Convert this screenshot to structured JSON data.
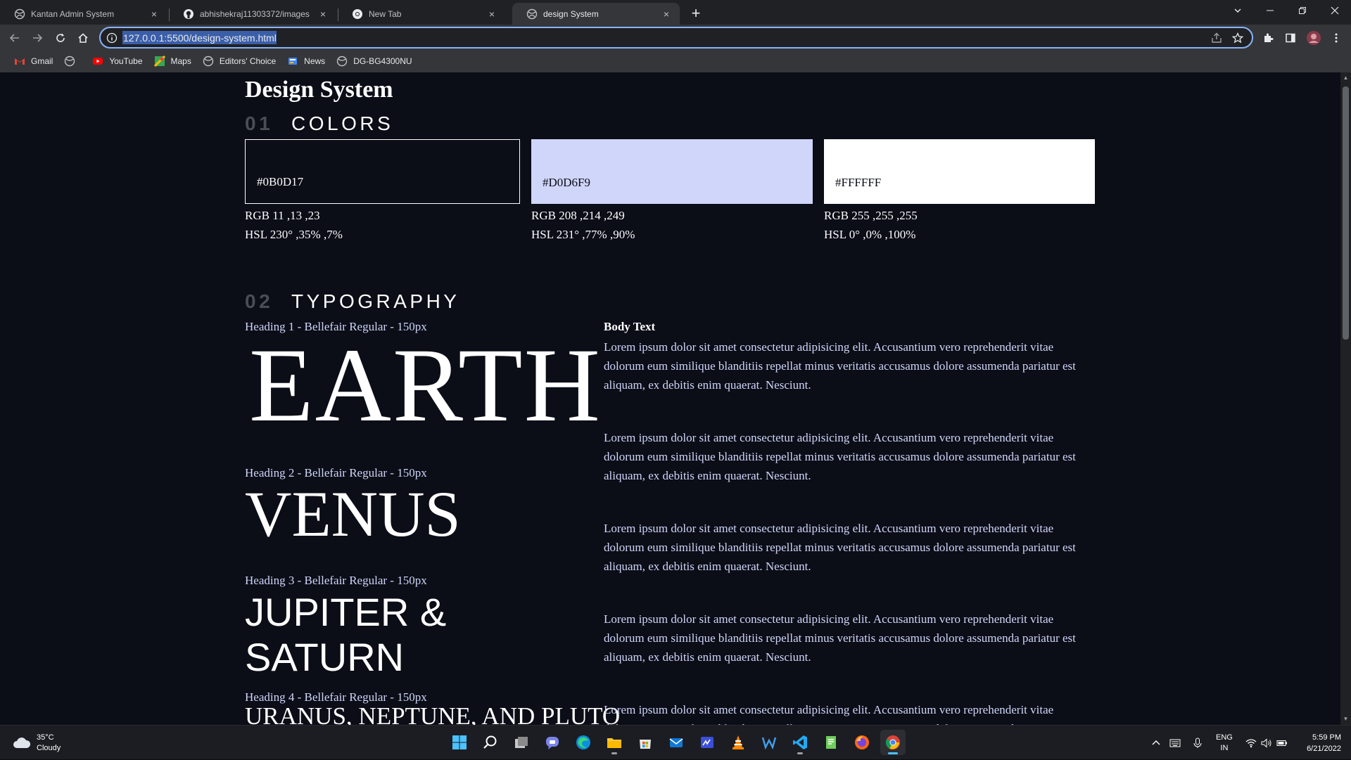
{
  "browser": {
    "tabs": [
      {
        "title": "Kantan Admin System",
        "icon": "globe-icon",
        "active": false
      },
      {
        "title": "abhishekraj11303372/images",
        "icon": "github-icon",
        "active": false
      },
      {
        "title": "New Tab",
        "icon": "chrome-icon",
        "active": false
      },
      {
        "title": "design System",
        "icon": "globe-icon",
        "active": true
      }
    ],
    "tab_close_glyph": "×",
    "new_tab_glyph": "+",
    "url": "127.0.0.1:5500/design-system.html",
    "bookmarks": [
      {
        "label": "Gmail",
        "icon": "gmail-icon"
      },
      {
        "label": "",
        "icon": "globe-icon"
      },
      {
        "label": "YouTube",
        "icon": "youtube-icon"
      },
      {
        "label": "Maps",
        "icon": "maps-icon"
      },
      {
        "label": "Editors' Choice",
        "icon": "globe-icon"
      },
      {
        "label": "News",
        "icon": "news-icon"
      },
      {
        "label": "DG-BG4300NU",
        "icon": "globe-icon"
      }
    ],
    "colors": {
      "accent": "#8ab4f8",
      "tabbar": "#202124",
      "toolbar": "#35363a"
    }
  },
  "page": {
    "title": "Design System",
    "sections": {
      "colors": {
        "num": "01",
        "name": "COLORS"
      },
      "typography": {
        "num": "02",
        "name": "TYPOGRAPHY"
      }
    },
    "swatches": [
      {
        "hex": "#0B0D17",
        "rgb": "RGB 11 ,13 ,23",
        "hsl": "HSL 230° ,35% ,7%",
        "color": "#0B0D17"
      },
      {
        "hex": "#D0D6F9",
        "rgb": "RGB 208 ,214 ,249",
        "hsl": "HSL 231° ,77% ,90%",
        "color": "#D0D6F9"
      },
      {
        "hex": "#FFFFFF",
        "rgb": "RGB 255 ,255 ,255",
        "hsl": "HSL 0° ,0% ,100%",
        "color": "#FFFFFF"
      }
    ],
    "typography": {
      "h1_label": "Heading 1 - Bellefair Regular - 150px",
      "h1_sample": "EARTH",
      "h2_label": "Heading 2 - Bellefair Regular - 150px",
      "h2_sample": "VENUS",
      "h3_label": "Heading 3 - Bellefair Regular - 150px",
      "h3_sample": "JUPITER & SATURN",
      "h4_label": "Heading 4 - Bellefair Regular - 150px",
      "h4_sample": "URANUS, NEPTUNE, AND PLUTO",
      "body_label": "Body Text",
      "body_paragraphs": [
        "Lorem ipsum dolor sit amet consectetur adipisicing elit. Accusantium vero reprehenderit vitae dolorum eum similique blanditiis repellat minus veritatis accusamus dolore assumenda pariatur est aliquam, ex debitis enim quaerat. Nesciunt.",
        "Lorem ipsum dolor sit amet consectetur adipisicing elit. Accusantium vero reprehenderit vitae dolorum eum similique blanditiis repellat minus veritatis accusamus dolore assumenda pariatur est aliquam, ex debitis enim quaerat. Nesciunt.",
        "Lorem ipsum dolor sit amet consectetur adipisicing elit. Accusantium vero reprehenderit vitae dolorum eum similique blanditiis repellat minus veritatis accusamus dolore assumenda pariatur est aliquam, ex debitis enim quaerat. Nesciunt.",
        "Lorem ipsum dolor sit amet consectetur adipisicing elit. Accusantium vero reprehenderit vitae dolorum eum similique blanditiis repellat minus veritatis accusamus dolore assumenda pariatur est aliquam, ex debitis enim quaerat. Nesciunt.",
        "Lorem ipsum dolor sit amet consectetur adipisicing elit. Accusantium vero reprehenderit vitae dolorum eum similique blanditiis repellat minus veritatis accusamus dolore assumenda pariatur est aliquam, ex debitis enim quaerat. Nesciunt."
      ]
    }
  },
  "taskbar": {
    "weather_temp": "35°C",
    "weather_desc": "Cloudy",
    "apps": [
      "start-icon",
      "search-icon",
      "task-view-icon",
      "chat-icon",
      "edge-icon",
      "file-explorer-icon",
      "store-icon",
      "mail-icon",
      "whiteboard-icon",
      "vlc-icon",
      "wps-icon",
      "vscode-icon",
      "notepad-icon",
      "firefox-icon",
      "chrome-icon"
    ],
    "lang_top": "ENG",
    "lang_bottom": "IN",
    "time": "5:59 PM",
    "date": "6/21/2022"
  }
}
